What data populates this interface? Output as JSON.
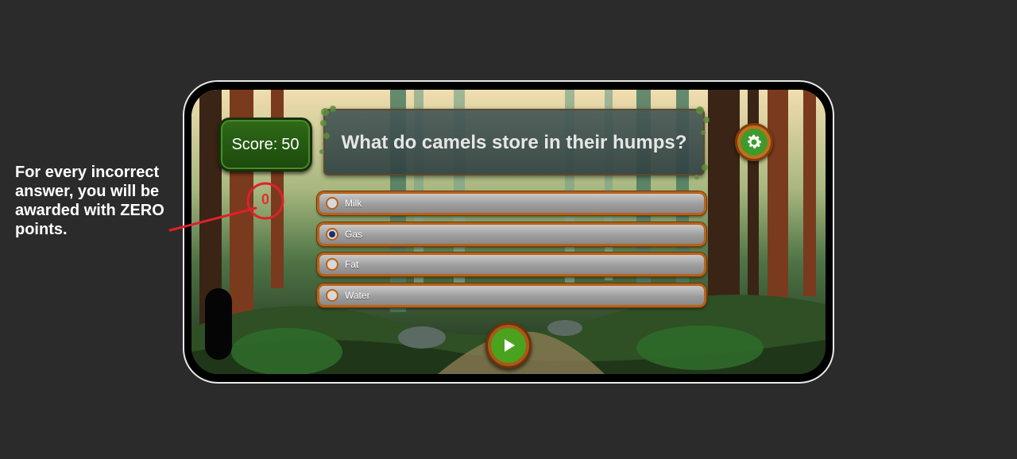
{
  "annotation": {
    "text": "For every incorrect answer, you will be awarded with ZERO points.",
    "color": "#e0202c"
  },
  "game": {
    "score_label": "Score:",
    "score_value": "50",
    "zero_marker": "0",
    "question": "What do camels store in their humps?",
    "options": [
      {
        "label": "Milk",
        "selected": false
      },
      {
        "label": "Gas",
        "selected": true
      },
      {
        "label": "Fat",
        "selected": false
      },
      {
        "label": "Water",
        "selected": false
      }
    ],
    "icons": {
      "settings": "gear-icon",
      "play": "play-icon"
    },
    "colors": {
      "option_border": "#b8621a",
      "badge_green": "#2f6a18",
      "play_green": "#4aa21e"
    }
  }
}
